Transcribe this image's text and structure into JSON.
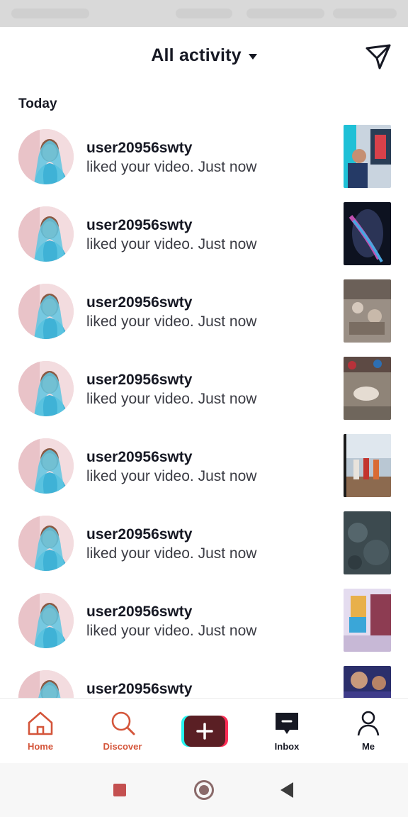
{
  "header": {
    "title": "All activity"
  },
  "section": {
    "label": "Today"
  },
  "notifications": [
    {
      "username": "user20956swty",
      "message": "liked your video. Just now"
    },
    {
      "username": "user20956swty",
      "message": "liked your video. Just now"
    },
    {
      "username": "user20956swty",
      "message": "liked your video. Just now"
    },
    {
      "username": "user20956swty",
      "message": "liked your video. Just now"
    },
    {
      "username": "user20956swty",
      "message": "liked your video. Just now"
    },
    {
      "username": "user20956swty",
      "message": "liked your video. Just now"
    },
    {
      "username": "user20956swty",
      "message": "liked your video. Just now"
    },
    {
      "username": "user20956swty",
      "message": ""
    }
  ],
  "tabbar": {
    "home": "Home",
    "discover": "Discover",
    "inbox": "Inbox",
    "me": "Me"
  },
  "colors": {
    "accent": "#d4553a",
    "text": "#161823",
    "create_pink": "#fe2c55",
    "create_cyan": "#25f4ee"
  },
  "icons": {
    "header_action": "send-icon",
    "home": "home-icon",
    "discover": "search-icon",
    "create": "plus-icon",
    "inbox": "inbox-icon",
    "me": "profile-icon"
  }
}
